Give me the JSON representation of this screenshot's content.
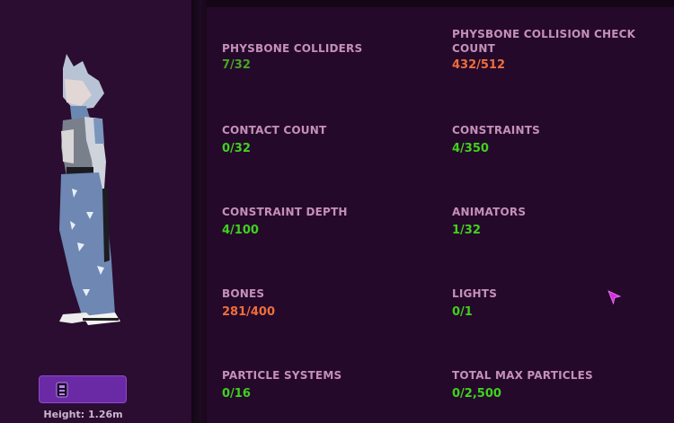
{
  "stats": [
    {
      "label": "PHYSBONE COLLIDERS",
      "value": "7/32",
      "status": "ok"
    },
    {
      "label": "PHYSBONE COLLISION CHECK COUNT",
      "value": "432/512",
      "status": "warn"
    },
    {
      "label": "CONTACT COUNT",
      "value": "0/32",
      "status": "ok"
    },
    {
      "label": "CONSTRAINTS",
      "value": "4/350",
      "status": "ok"
    },
    {
      "label": "CONSTRAINT DEPTH",
      "value": "4/100",
      "status": "ok"
    },
    {
      "label": "ANIMATORS",
      "value": "1/32",
      "status": "ok"
    },
    {
      "label": "BONES",
      "value": "281/400",
      "status": "warn"
    },
    {
      "label": "LIGHTS",
      "value": "0/1",
      "status": "ok"
    },
    {
      "label": "PARTICLE SYSTEMS",
      "value": "0/16",
      "status": "ok"
    },
    {
      "label": "TOTAL MAX PARTICLES",
      "value": "0/2,500",
      "status": "ok"
    }
  ],
  "colors": {
    "ok": "#3fd21b",
    "warn": "#ee6d3a",
    "ok_dim": "#48a622",
    "label": "#c590b8"
  },
  "avatar": {
    "height_text": "Height: 1.26m"
  },
  "icons": {
    "action_button": "avatar-stats-icon",
    "cursor": "pointer-cursor-icon"
  }
}
